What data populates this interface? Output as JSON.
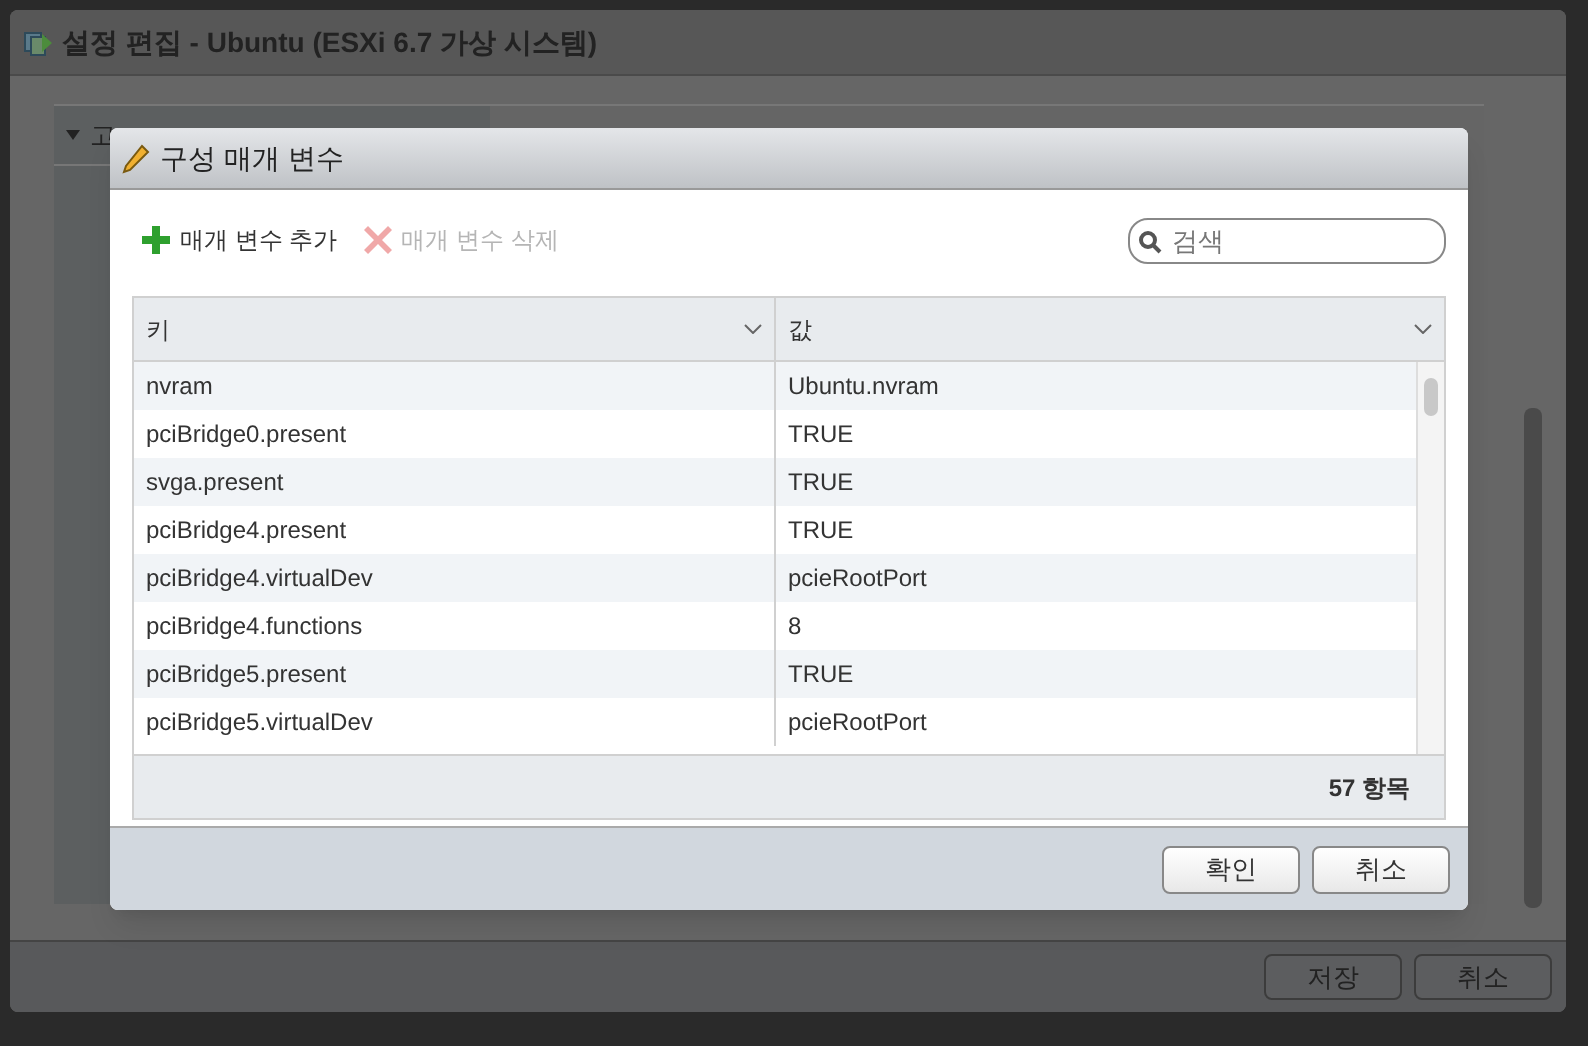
{
  "window": {
    "title": "설정 편집 - Ubuntu (ESXi 6.7 가상 시스템)",
    "section_header": "고",
    "buttons": [
      "저장",
      "취소"
    ]
  },
  "dialog": {
    "title": "구성 매개 변수",
    "toolbar": [
      {
        "label": "매개 변수 추가",
        "disabled": false,
        "kind": "add"
      },
      {
        "label": "매개 변수 삭제",
        "disabled": true,
        "kind": "remove"
      }
    ],
    "search": {
      "placeholder": "검색"
    },
    "table": {
      "columns": [
        "키",
        "값"
      ],
      "rows": [
        [
          "nvram",
          "Ubuntu.nvram"
        ],
        [
          "pciBridge0.present",
          "TRUE"
        ],
        [
          "svga.present",
          "TRUE"
        ],
        [
          "pciBridge4.present",
          "TRUE"
        ],
        [
          "pciBridge4.virtualDev",
          "pcieRootPort"
        ],
        [
          "pciBridge4.functions",
          "8"
        ],
        [
          "pciBridge5.present",
          "TRUE"
        ],
        [
          "pciBridge5.virtualDev",
          "pcieRootPort"
        ]
      ],
      "footer": "57 항목"
    },
    "buttons": [
      "확인",
      "취소"
    ]
  }
}
